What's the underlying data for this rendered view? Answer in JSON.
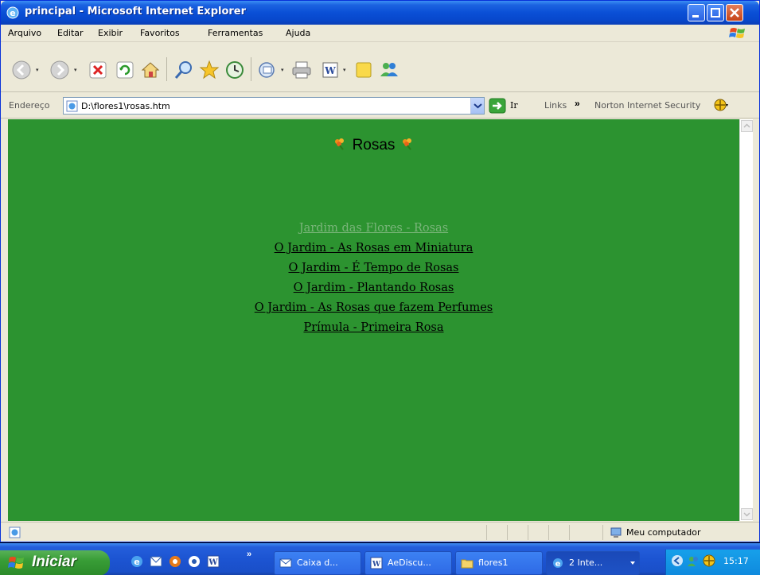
{
  "window": {
    "title": "principal - Microsoft Internet Explorer"
  },
  "menu": {
    "items": [
      "Arquivo",
      "Editar",
      "Exibir",
      "Favoritos",
      "Ferramentas",
      "Ajuda"
    ]
  },
  "toolbar": {
    "icons": [
      "back-icon",
      "forward-icon",
      "stop-icon",
      "refresh-icon",
      "home-icon",
      "search-icon",
      "favorites-icon",
      "history-icon",
      "mail-icon",
      "print-icon",
      "edit-icon",
      "notes-icon",
      "messenger-icon"
    ]
  },
  "address": {
    "label": "Endereço",
    "value": "D:\\flores1\\rosas.htm",
    "go_label": "Ir",
    "links_label": "Links",
    "links_chevron": "»",
    "norton_label": "Norton Internet Security"
  },
  "page": {
    "background": "#2c9330",
    "heading": "Rosas",
    "links": [
      {
        "text": "Jardim das Flores - Rosas",
        "visited": true
      },
      {
        "text": "O Jardim - As Rosas em Miniatura",
        "visited": false
      },
      {
        "text": "O Jardim - É Tempo de Rosas",
        "visited": false
      },
      {
        "text": "O Jardim - Plantando Rosas",
        "visited": false
      },
      {
        "text": "O Jardim - As Rosas que fazem Perfumes",
        "visited": false
      },
      {
        "text": "Prímula - Primeira Rosa",
        "visited": false
      }
    ]
  },
  "status": {
    "zone": "Meu computador"
  },
  "taskbar": {
    "start_label": "Iniciar",
    "quick_launch_more": "»",
    "tasks": [
      {
        "label": "Caixa d...",
        "icon": "outlook-icon",
        "active": false
      },
      {
        "label": "AeDiscu...",
        "icon": "word-icon",
        "active": false
      },
      {
        "label": "flores1",
        "icon": "folder-icon",
        "active": false
      },
      {
        "label": "2 Inte...",
        "icon": "ie-icon",
        "active": true
      }
    ],
    "time": "15:17"
  }
}
